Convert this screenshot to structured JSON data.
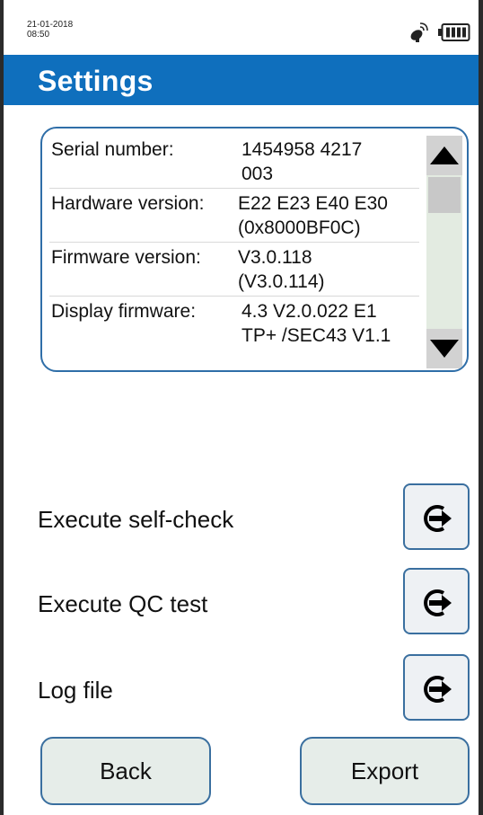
{
  "status": {
    "date": "21-01-2018",
    "time": "08:50",
    "icons": [
      "satellite-icon",
      "battery-icon"
    ]
  },
  "header": {
    "title": "Settings"
  },
  "info": {
    "rows": [
      {
        "label": "Serial number:",
        "lines": [
          "1454958 4217",
          "003"
        ]
      },
      {
        "label": "Hardware version:",
        "lines": [
          "E22 E23 E40 E30",
          "(0x8000BF0C)"
        ]
      },
      {
        "label": "Firmware version:",
        "lines": [
          "V3.0.118",
          "(V3.0.114)"
        ]
      },
      {
        "label": "Display firmware:",
        "lines": [
          "4.3 V2.0.022 E1",
          "TP+ /SEC43 V1.1"
        ]
      }
    ]
  },
  "actions": [
    {
      "label": "Execute self-check",
      "icon": "arrow-right-circle-icon"
    },
    {
      "label": "Execute QC test",
      "icon": "arrow-right-circle-icon"
    },
    {
      "label": "Log file",
      "icon": "arrow-right-circle-icon"
    }
  ],
  "footer": {
    "back_label": "Back",
    "export_label": "Export"
  },
  "colors": {
    "header_bg": "#0f6fbd",
    "border": "#3a6f9f"
  }
}
